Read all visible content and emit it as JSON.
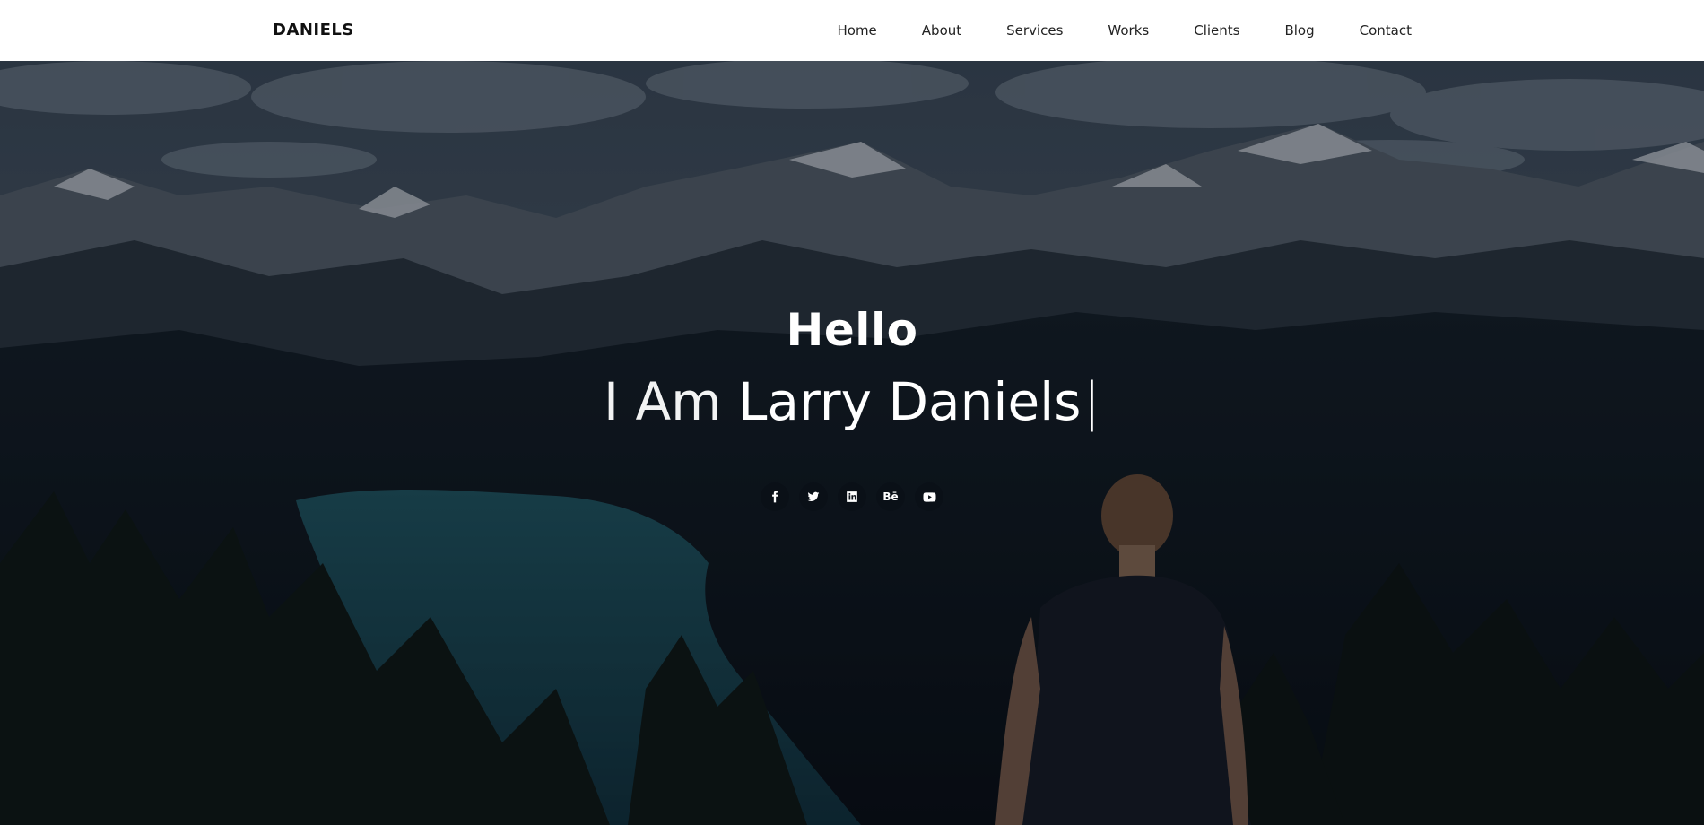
{
  "brand": "DANIELS",
  "nav": {
    "items": [
      "Home",
      "About",
      "Services",
      "Works",
      "Clients",
      "Blog",
      "Contact"
    ]
  },
  "hero": {
    "greeting": "Hello",
    "intro_prefix": "I Am ",
    "name": "Larry Daniels",
    "cursor": "|",
    "background": "mountain-lake-landscape-photo"
  },
  "socials": [
    {
      "icon": "facebook-icon"
    },
    {
      "icon": "twitter-icon"
    },
    {
      "icon": "linkedin-icon"
    },
    {
      "icon": "behance-icon",
      "label": "Bē"
    },
    {
      "icon": "youtube-icon"
    }
  ],
  "colors": {
    "nav_bg": "#ffffff",
    "nav_text": "#222222",
    "hero_text": "#ffffff"
  }
}
